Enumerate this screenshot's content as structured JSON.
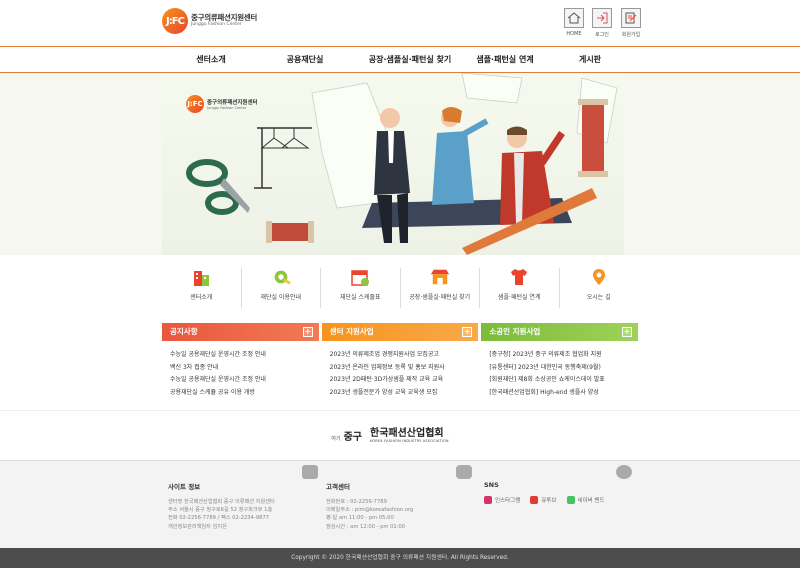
{
  "header": {
    "logo_mark": "J:FC",
    "logo_name": "중구의류패션지원센터",
    "logo_sub": "Junggu Fashion Center",
    "util": [
      {
        "label": "HOME",
        "icon": "home-icon"
      },
      {
        "label": "로그인",
        "icon": "login-icon"
      },
      {
        "label": "회원가입",
        "icon": "signup-icon"
      }
    ]
  },
  "nav": {
    "items": [
      "센터소개",
      "공용재단실",
      "공장·샘플실·패턴실 찾기",
      "샘플·패턴실 연계",
      "게시판"
    ]
  },
  "hero": {
    "logo_mark": "J:FC",
    "logo_name": "중구의류패션지원센터",
    "logo_sub": "Junggu Fashion Center"
  },
  "quick": [
    {
      "label": "센터소개",
      "icon": "building-icon"
    },
    {
      "label": "재단실 이용안내",
      "icon": "measuring-tape-icon"
    },
    {
      "label": "재단실 스케줄표",
      "icon": "calendar-icon"
    },
    {
      "label": "공장·샘플실·패턴실 찾기",
      "icon": "shop-icon"
    },
    {
      "label": "샘플·패턴실 연계",
      "icon": "tshirt-icon"
    },
    {
      "label": "오시는 길",
      "icon": "map-pin-icon"
    }
  ],
  "boards": [
    {
      "title": "공지사항",
      "color": "#e9573f",
      "items": [
        "수능일 공용재단실 운영시간 조정 안내",
        "백신 3차 접종 안내",
        "수능일 공용재단실 운영시간 조정 안내",
        "공용재단실 스케쥴 공유 이용 개방"
      ]
    },
    {
      "title": "센터 지원사업",
      "color": "#f7931e",
      "items": [
        "2023년 의류제조업 경쟁지원사업 모집공고",
        "2023년 온라인 업체정보 등록 및 홍보 지원사",
        "2023년 2D패턴·3D가상샘플 제작 교육 교육",
        "2023년 생플전문가 양성 교육 교육생 모집"
      ]
    },
    {
      "title": "소공인 지원사업",
      "color": "#8cc63f",
      "items": [
        "[중구청] 2023년 중구 의류제조 협업화 지원",
        "[유통센터] 2023년 대한민국 동행축제(9월)",
        "[회원재단] 제8회 소상공인 쇼케이스데이 발표",
        "[한국패션산업협회] High-end 생플사 양성"
      ]
    }
  ],
  "banner": {
    "city_prefix": "여기",
    "city_mid": "중구",
    "city_name": "중구",
    "kfia_name": "한국패션산업협회",
    "kfia_en": "KOREA FASHION INDUSTRY ASSOCIATION"
  },
  "footer": {
    "site": {
      "title": "사이트 정보",
      "lines": [
        "센터명 한국패션산업협회 중구 의류패션 지원센터",
        "주소 서울시 중구 청구로6길 52 청구파크뷰 1층",
        "전화 02-2256-7789 / 팩스 02-2234-9877",
        "개인정보관리책임자 임지은"
      ]
    },
    "contact": {
      "title": "고객센터",
      "lines": [
        "전화번호 : 02-2256-7789",
        "이메일주소 : pim@koreafashion.org",
        "평·일 am 11:00 - pm 05:00",
        "점심시간 : am 12:00 - pm 01:00"
      ]
    },
    "sns": {
      "title": "SNS",
      "items": [
        {
          "label": "인스타그램",
          "color": "#d6336c"
        },
        {
          "label": "유투브",
          "color": "#e53935"
        },
        {
          "label": "네이버 밴드",
          "color": "#43c463"
        }
      ]
    }
  },
  "copyright": "Copyright © 2020 한국패션산업협회 중구 의류패션 지원센터. All Rights Reserved."
}
